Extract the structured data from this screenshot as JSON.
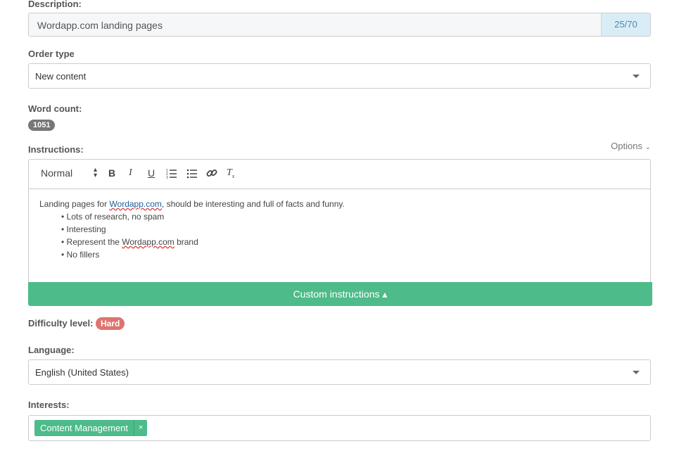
{
  "description": {
    "label": "Description:",
    "value": "Wordapp.com landing pages",
    "counter": "25/70"
  },
  "order_type": {
    "label": "Order type",
    "value": "New content"
  },
  "word_count": {
    "label": "Word count:",
    "value": "1051"
  },
  "instructions": {
    "label": "Instructions:",
    "options_label": "Options",
    "toolbar": {
      "format": "Normal"
    },
    "content": {
      "line_pre": "Landing pages for ",
      "line_link": "Wordapp.com",
      "line_post": ", should be interesting and full of facts and funny.",
      "bullets": [
        "Lots of research, no spam",
        "Interesting",
        "Represent the ",
        "No fillers"
      ],
      "bullet3_link": "Wordapp.com",
      "bullet3_post": " brand"
    },
    "custom_button": "Custom instructions ▴"
  },
  "difficulty": {
    "label": "Difficulty level:",
    "value": "Hard"
  },
  "language": {
    "label": "Language:",
    "value": "English (United States)"
  },
  "interests": {
    "label": "Interests:",
    "tags": [
      "Content Management"
    ],
    "remove": "×"
  },
  "colors": {
    "accent": "#4dbb8a",
    "difficulty": "#e0736d",
    "counter_bg": "#d9edf7"
  }
}
